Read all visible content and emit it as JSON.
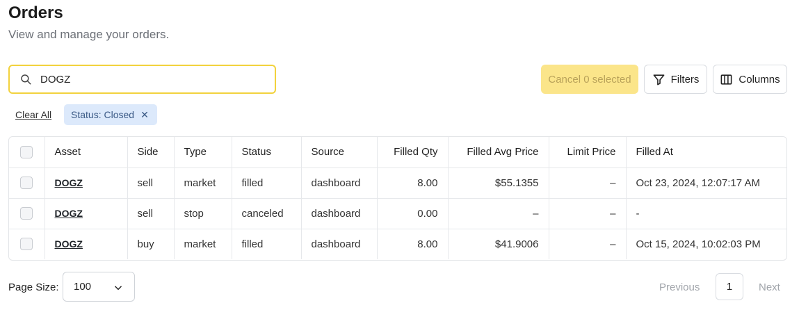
{
  "header": {
    "title": "Orders",
    "subtitle": "View and manage your orders."
  },
  "search": {
    "value": "DOGZ",
    "icon": "search-icon"
  },
  "toolbar": {
    "cancel_label": "Cancel 0 selected",
    "filters_label": "Filters",
    "columns_label": "Columns"
  },
  "filters": {
    "clear_all_label": "Clear All",
    "chips": [
      {
        "label": "Status: Closed",
        "remove": "✕"
      }
    ]
  },
  "table": {
    "columns": [
      "Asset",
      "Side",
      "Type",
      "Status",
      "Source",
      "Filled Qty",
      "Filled Avg Price",
      "Limit Price",
      "Filled At"
    ],
    "rows": [
      {
        "asset": "DOGZ",
        "side": "sell",
        "type": "market",
        "status": "filled",
        "source": "dashboard",
        "filled_qty": "8.00",
        "filled_avg_price": "$55.1355",
        "limit_price": "–",
        "filled_at": "Oct 23, 2024, 12:07:17 AM"
      },
      {
        "asset": "DOGZ",
        "side": "sell",
        "type": "stop",
        "status": "canceled",
        "source": "dashboard",
        "filled_qty": "0.00",
        "filled_avg_price": "–",
        "limit_price": "–",
        "filled_at": "-"
      },
      {
        "asset": "DOGZ",
        "side": "buy",
        "type": "market",
        "status": "filled",
        "source": "dashboard",
        "filled_qty": "8.00",
        "filled_avg_price": "$41.9006",
        "limit_price": "–",
        "filled_at": "Oct 15, 2024, 10:02:03 PM"
      }
    ]
  },
  "pagination": {
    "page_size_label": "Page Size:",
    "page_size_value": "100",
    "previous_label": "Previous",
    "current_page": "1",
    "next_label": "Next"
  },
  "colors": {
    "accent": "#f2d23d",
    "cancel_bg": "#fbe58a",
    "chip_bg": "#dce9fb"
  }
}
